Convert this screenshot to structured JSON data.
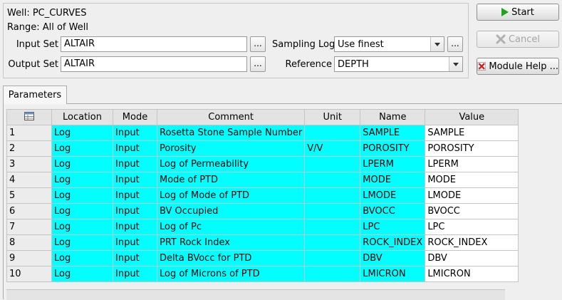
{
  "info": {
    "well": "Well: PC_CURVES",
    "range": "Range: All of Well"
  },
  "input_set": {
    "label": "Input Set",
    "value": "ALTAIR",
    "browse": "..."
  },
  "output_set": {
    "label": "Output Set",
    "value": "ALTAIR",
    "browse": "..."
  },
  "sampling_log": {
    "label": "Sampling Log",
    "value": "Use finest",
    "browse": "..."
  },
  "reference": {
    "label": "Reference",
    "value": "DEPTH"
  },
  "buttons": {
    "start": "Start",
    "cancel": "Cancel",
    "help": "Module Help ..."
  },
  "tabs": [
    {
      "label": "Parameters"
    }
  ],
  "table": {
    "headers": [
      "Location",
      "Mode",
      "Comment",
      "Unit",
      "Name",
      "Value"
    ],
    "rows": [
      {
        "n": "1",
        "location": "Log",
        "mode": "Input",
        "comment": "Rosetta Stone Sample Number",
        "unit": "",
        "name": "SAMPLE",
        "value": "SAMPLE"
      },
      {
        "n": "2",
        "location": "Log",
        "mode": "Input",
        "comment": "Porosity",
        "unit": "V/V",
        "name": "POROSITY",
        "value": "POROSITY"
      },
      {
        "n": "3",
        "location": "Log",
        "mode": "Input",
        "comment": "Log of Permeability",
        "unit": "",
        "name": "LPERM",
        "value": "LPERM"
      },
      {
        "n": "4",
        "location": "Log",
        "mode": "Input",
        "comment": "Mode of PTD",
        "unit": "",
        "name": "MODE",
        "value": "MODE"
      },
      {
        "n": "5",
        "location": "Log",
        "mode": "Input",
        "comment": "Log of Mode of PTD",
        "unit": "",
        "name": "LMODE",
        "value": "LMODE"
      },
      {
        "n": "6",
        "location": "Log",
        "mode": "Input",
        "comment": "BV Occupied",
        "unit": "",
        "name": "BVOCC",
        "value": "BVOCC"
      },
      {
        "n": "7",
        "location": "Log",
        "mode": "Input",
        "comment": "Log of Pc",
        "unit": "",
        "name": "LPC",
        "value": "LPC"
      },
      {
        "n": "8",
        "location": "Log",
        "mode": "Input",
        "comment": "PRT Rock Index",
        "unit": "",
        "name": "ROCK_INDEX",
        "value": "ROCK_INDEX"
      },
      {
        "n": "9",
        "location": "Log",
        "mode": "Input",
        "comment": "Delta BVocc for PTD",
        "unit": "",
        "name": "DBV",
        "value": "DBV"
      },
      {
        "n": "10",
        "location": "Log",
        "mode": "Input",
        "comment": "Log of Microns of PTD",
        "unit": "",
        "name": "LMICRON",
        "value": "LMICRON"
      }
    ]
  },
  "colors": {
    "cyan_cell": "#00ffff",
    "start_icon": "#1da51d",
    "help_icon": "#d42020"
  },
  "icons": {
    "start": "play-icon",
    "cancel": "x-icon",
    "help": "help-icon",
    "table_corner": "table-menu-icon"
  }
}
